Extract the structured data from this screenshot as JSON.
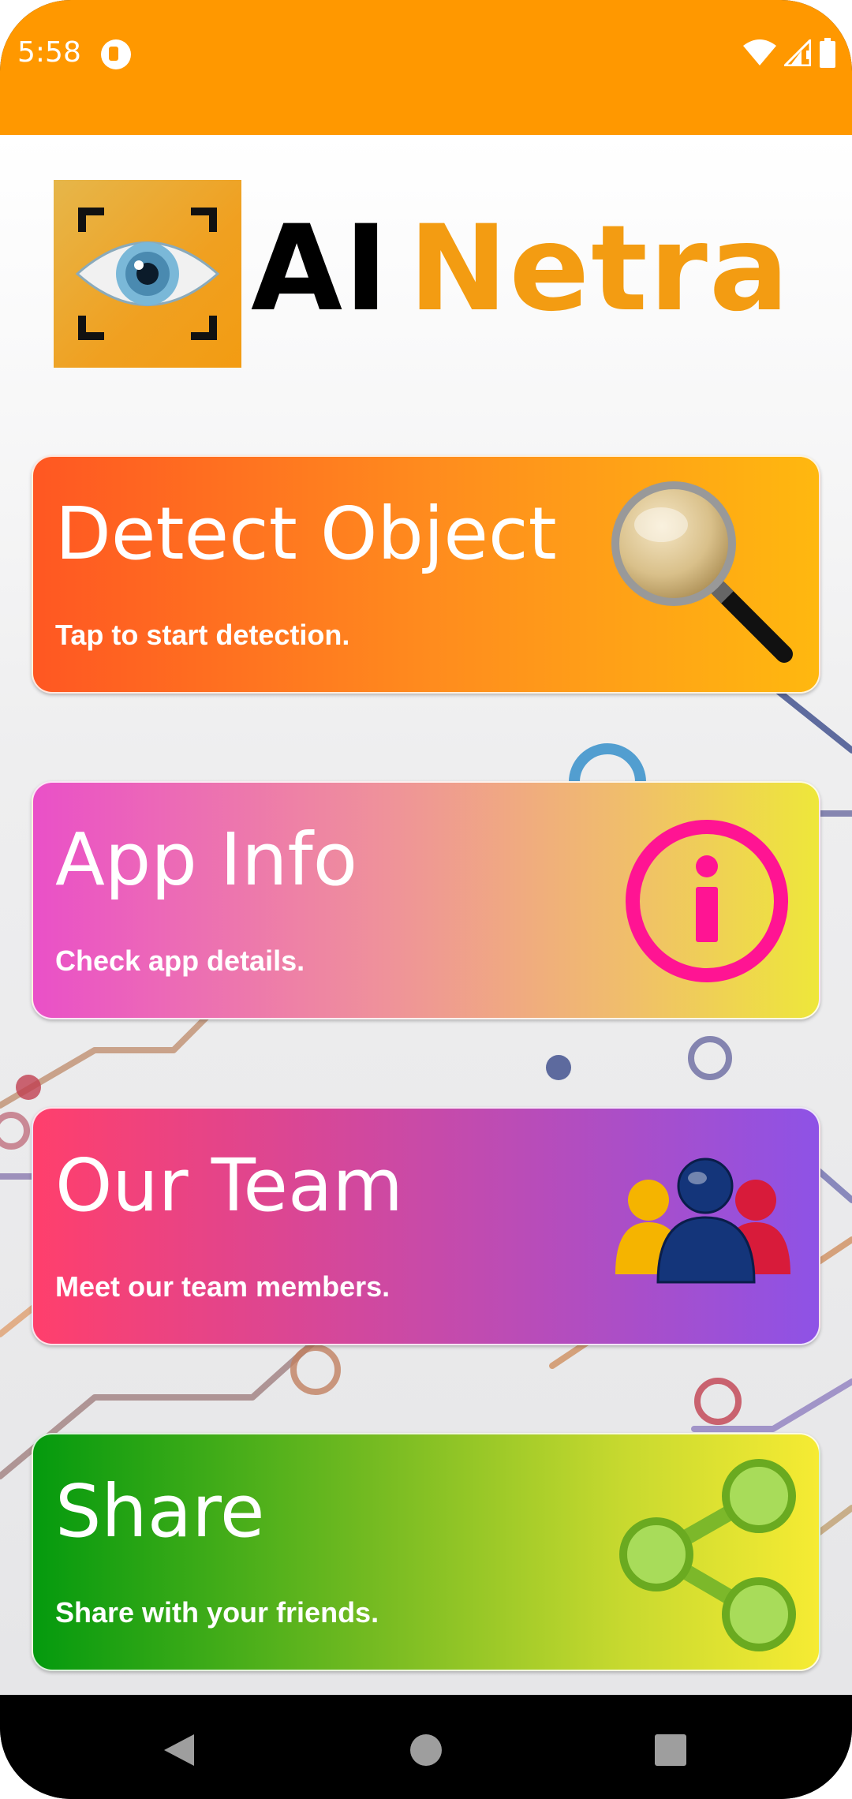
{
  "status_bar": {
    "time": "5:58",
    "background": "#FF9800",
    "icons": [
      "app-notification-icon",
      "wifi-icon",
      "cellular-signal-icon",
      "battery-icon"
    ]
  },
  "logo": {
    "word_ai": "AI",
    "word_netra": "Netra",
    "accent_color": "#F39C12",
    "icon": "eye-in-viewfinder-icon"
  },
  "cards": [
    {
      "title": "Detect Object",
      "subtitle": "Tap to start detection.",
      "icon": "magnifier-icon"
    },
    {
      "title": "App Info",
      "subtitle": "Check app details.",
      "icon": "info-icon"
    },
    {
      "title": "Our Team",
      "subtitle": "Meet our team members.",
      "icon": "team-people-icon"
    },
    {
      "title": "Share",
      "subtitle": "Share with your friends.",
      "icon": "share-icon"
    }
  ],
  "nav_bar": {
    "buttons": [
      "back-icon",
      "home-icon",
      "recents-icon"
    ]
  }
}
